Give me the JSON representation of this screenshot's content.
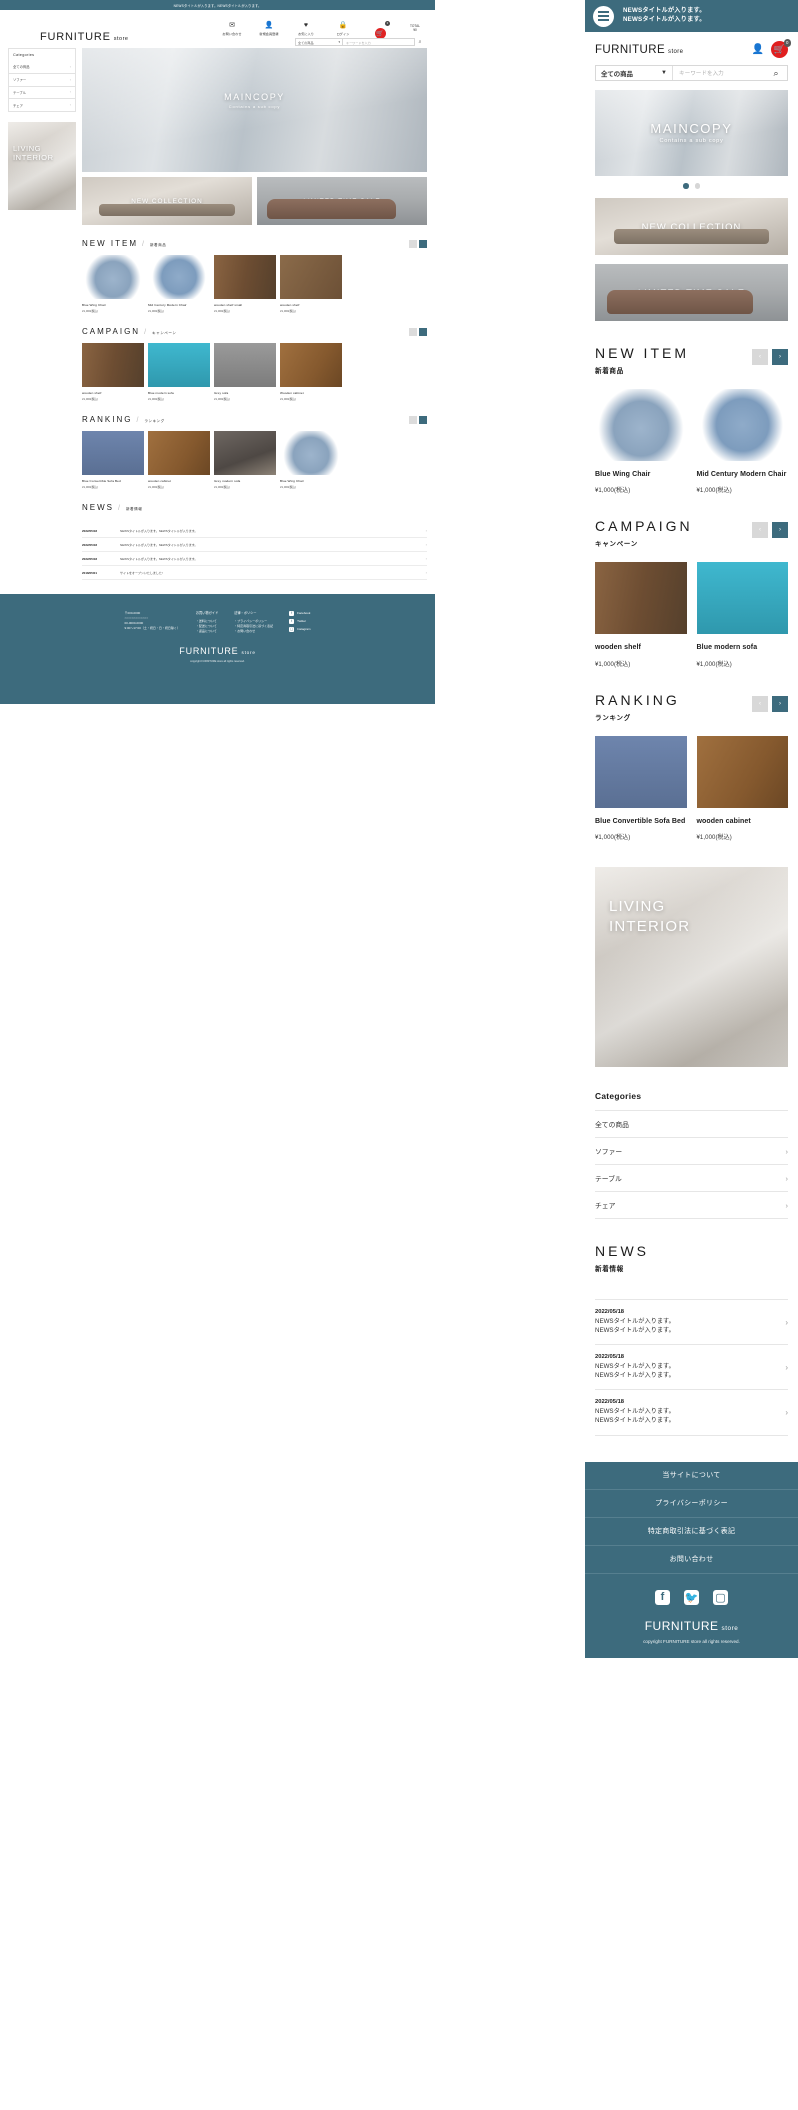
{
  "brand": {
    "name": "FURNITURE",
    "suffix": "store",
    "accent": "#3d6b7d",
    "cart_accent": "#e01f1f"
  },
  "newsbar": {
    "line1": "NEWSタイトルが入ります。",
    "line2": "NEWSタイトルが入ります。",
    "desktop_text": "NEWSタイトルが入ります。NEWSタイトルが入ります。"
  },
  "utility": [
    {
      "icon": "mail-icon",
      "glyph": "✉",
      "label": "お問い合わせ"
    },
    {
      "icon": "person-icon",
      "glyph": "👤",
      "label": "新規会員登録"
    },
    {
      "icon": "heart-icon",
      "glyph": "♥",
      "label": "お気に入り"
    },
    {
      "icon": "lock-icon",
      "glyph": "🔒",
      "label": "ログイン"
    }
  ],
  "cart": {
    "icon": "cart-icon",
    "glyph": "🛒",
    "badge": "0",
    "total_label": "TOTAL",
    "total_value": "¥0"
  },
  "search": {
    "category_selected": "全ての商品",
    "placeholder": "キーワードを入力",
    "button_icon": "search-icon"
  },
  "hero": {
    "title": "MAINCOPY",
    "subtitle": "Contains a sub copy",
    "dots": 2,
    "active_dot": 0
  },
  "banners": [
    {
      "label": "NEW COLLECTION"
    },
    {
      "label": "LIMITED TIME SALE"
    }
  ],
  "sidebar": {
    "heading": "Categories",
    "items": [
      {
        "label": "全ての商品",
        "chevron": false
      },
      {
        "label": "ソファー",
        "chevron": true
      },
      {
        "label": "テーブル",
        "chevron": true
      },
      {
        "label": "チェア",
        "chevron": true
      }
    ],
    "promo": {
      "line1": "LIVING",
      "line2": "INTERIOR"
    }
  },
  "sections": [
    {
      "id": "new-item",
      "en": "NEW ITEM",
      "jp": "新着商品",
      "products": [
        {
          "name": "Blue Wing Chair",
          "price": "¥1,000(税込)",
          "thumb": "ph-chair-blue"
        },
        {
          "name": "Mid Century Modern Chair",
          "price": "¥1,000(税込)",
          "thumb": "ph-chair-blue2"
        },
        {
          "name": "wooden shelf small",
          "price": "¥1,000(税込)",
          "thumb": "ph-shelf"
        },
        {
          "name": "wooden shelf",
          "price": "¥1,000(税込)",
          "thumb": "ph-cabinet"
        }
      ]
    },
    {
      "id": "campaign",
      "en": "CAMPAIGN",
      "jp": "キャンペーン",
      "products": [
        {
          "name": "wooden shelf",
          "price": "¥1,000(税込)",
          "thumb": "ph-shelf"
        },
        {
          "name": "Blue modern sofa",
          "price": "¥1,000(税込)",
          "thumb": "ph-sofa-teal"
        },
        {
          "name": "Grey sofa",
          "price": "¥1,000(税込)",
          "thumb": "ph-sofa-grey"
        },
        {
          "name": "Wooden cabinet",
          "price": "¥1,000(税込)",
          "thumb": "ph-table-wood"
        }
      ]
    },
    {
      "id": "ranking",
      "en": "RANKING",
      "jp": "ランキング",
      "products": [
        {
          "name": "Blue Convertible Sofa Bed",
          "price": "¥1,000(税込)",
          "thumb": "ph-sofa-navy"
        },
        {
          "name": "wooden cabinet",
          "price": "¥1,000(税込)",
          "thumb": "ph-table-wood"
        },
        {
          "name": "Grey modern sofa",
          "price": "¥1,000(税込)",
          "thumb": "ph-sofa-rattan"
        },
        {
          "name": "Blue Wing Chair",
          "price": "¥1,000(税込)",
          "thumb": "ph-chair-blue"
        }
      ]
    }
  ],
  "news": {
    "en": "NEWS",
    "jp": "新着情報",
    "items": [
      {
        "date": "2022/05/18",
        "line1": "NEWSタイトルが入ります。",
        "line2": "NEWSタイトルが入ります。"
      },
      {
        "date": "2022/05/18",
        "line1": "NEWSタイトルが入ります。",
        "line2": "NEWSタイトルが入ります。"
      },
      {
        "date": "2022/05/18",
        "line1": "NEWSタイトルが入ります。",
        "line2": "NEWSタイトルが入ります。"
      },
      {
        "date": "2018/05/01",
        "line1": "サイトをオープンいたしました!",
        "line2": ""
      }
    ]
  },
  "footer": {
    "address_line1": "〒000-0000",
    "address_line2": "○○○○○○○○○○○○○",
    "tel": "00-0000-0000",
    "hours": "9:00〜17:00（土・祝日・日・祝日除く）",
    "columns": [
      {
        "heading": "お買い物ガイド",
        "rows": [
          "・送料について",
          "・配送について",
          "・返品について"
        ]
      },
      {
        "heading": "法律・ポリシー",
        "rows": [
          "・プライバシーポリシー",
          "・特定商取引法に基づく表記",
          "・お問い合わせ"
        ]
      }
    ],
    "sns": [
      {
        "icon": "facebook-icon",
        "glyph": "f",
        "label": "Facebook"
      },
      {
        "icon": "twitter-icon",
        "glyph": "t",
        "label": "Twitter"
      },
      {
        "icon": "instagram-icon",
        "glyph": "◻",
        "label": "Instagram"
      }
    ],
    "copyright": "copyright FURNITURE store all rights reserved.",
    "mobile_nav": [
      "当サイトについて",
      "プライバシーポリシー",
      "特定商取引法に基づく表記",
      "お問い合わせ"
    ]
  }
}
